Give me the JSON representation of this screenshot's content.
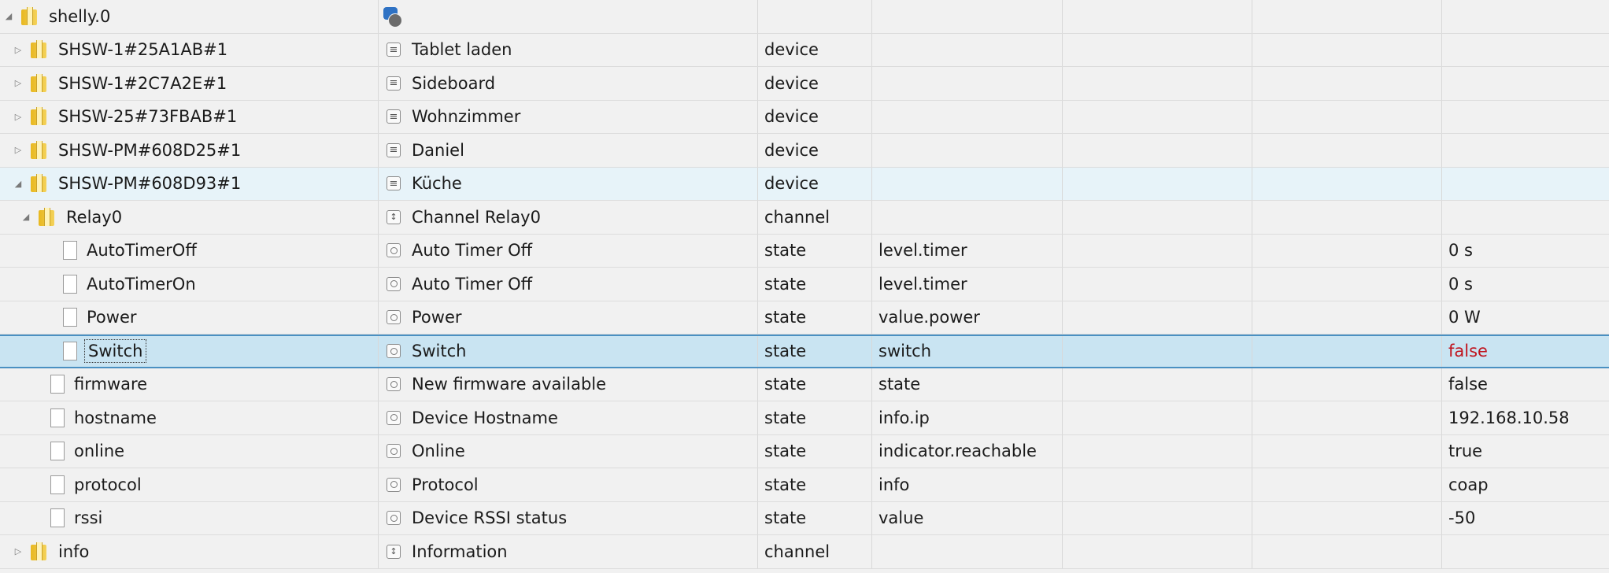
{
  "rows": [
    {
      "id": "shelly.0",
      "level": 0,
      "expand": "open",
      "kind": "folder",
      "adapter": true,
      "name": "",
      "role_icon": "",
      "type": "",
      "role": "",
      "value": ""
    },
    {
      "id": "SHSW-1#25A1AB#1",
      "level": 1,
      "expand": "closed",
      "kind": "folder",
      "name": "Tablet laden",
      "role_icon": "device",
      "type": "device",
      "role": "",
      "value": ""
    },
    {
      "id": "SHSW-1#2C7A2E#1",
      "level": 1,
      "expand": "closed",
      "kind": "folder",
      "name": "Sideboard",
      "role_icon": "device",
      "type": "device",
      "role": "",
      "value": ""
    },
    {
      "id": "SHSW-25#73FBAB#1",
      "level": 1,
      "expand": "closed",
      "kind": "folder",
      "name": "Wohnzimmer",
      "role_icon": "device",
      "type": "device",
      "role": "",
      "value": ""
    },
    {
      "id": "SHSW-PM#608D25#1",
      "level": 1,
      "expand": "closed",
      "kind": "folder",
      "name": "Daniel",
      "role_icon": "device",
      "type": "device",
      "role": "",
      "value": ""
    },
    {
      "id": "SHSW-PM#608D93#1",
      "level": 1,
      "expand": "open",
      "kind": "folder",
      "name": "Küche",
      "role_icon": "device",
      "type": "device",
      "role": "",
      "value": "",
      "state": "expanded"
    },
    {
      "id": "Relay0",
      "level": 2,
      "expand": "open",
      "kind": "folder",
      "name": "Channel Relay0",
      "role_icon": "channel",
      "type": "channel",
      "role": "",
      "value": ""
    },
    {
      "id": "AutoTimerOff",
      "level": 3,
      "expand": "none",
      "kind": "file",
      "name": "Auto Timer Off",
      "role_icon": "state",
      "type": "state",
      "role": "level.timer",
      "value": "0 s"
    },
    {
      "id": "AutoTimerOn",
      "level": 3,
      "expand": "none",
      "kind": "file",
      "name": "Auto Timer Off",
      "role_icon": "state",
      "type": "state",
      "role": "level.timer",
      "value": "0 s"
    },
    {
      "id": "Power",
      "level": 3,
      "expand": "none",
      "kind": "file",
      "name": "Power",
      "role_icon": "state",
      "type": "state",
      "role": "value.power",
      "value": "0 W"
    },
    {
      "id": "Switch",
      "level": 3,
      "expand": "none",
      "kind": "file",
      "name": "Switch",
      "role_icon": "state",
      "type": "state",
      "role": "switch",
      "value": "false",
      "state": "selected",
      "value_color": "#c0141e"
    },
    {
      "id": "firmware",
      "level": 2,
      "expand": "none",
      "kind": "file",
      "name": "New firmware available",
      "role_icon": "state",
      "type": "state",
      "role": "state",
      "value": "false"
    },
    {
      "id": "hostname",
      "level": 2,
      "expand": "none",
      "kind": "file",
      "name": "Device Hostname",
      "role_icon": "state",
      "type": "state",
      "role": "info.ip",
      "value": "192.168.10.58"
    },
    {
      "id": "online",
      "level": 2,
      "expand": "none",
      "kind": "file",
      "name": "Online",
      "role_icon": "state",
      "type": "state",
      "role": "indicator.reachable",
      "value": "true"
    },
    {
      "id": "protocol",
      "level": 2,
      "expand": "none",
      "kind": "file",
      "name": "Protocol",
      "role_icon": "state",
      "type": "state",
      "role": "info",
      "value": "coap"
    },
    {
      "id": "rssi",
      "level": 2,
      "expand": "none",
      "kind": "file",
      "name": "Device RSSI status",
      "role_icon": "state",
      "type": "state",
      "role": "value",
      "value": "-50"
    },
    {
      "id": "info",
      "level": 1,
      "expand": "closed",
      "kind": "folder",
      "name": "Information",
      "role_icon": "channel",
      "type": "channel",
      "role": "",
      "value": ""
    }
  ],
  "colors": {
    "selected_bg": "#c9e4f2",
    "expanded_bg": "#e7f3f9",
    "accent": "#4a90c2",
    "false_red": "#c0141e"
  },
  "icons": {
    "expand_open": "triangle-down-icon",
    "expand_closed": "triangle-right-icon",
    "folder": "folder-icon",
    "file": "file-icon"
  }
}
